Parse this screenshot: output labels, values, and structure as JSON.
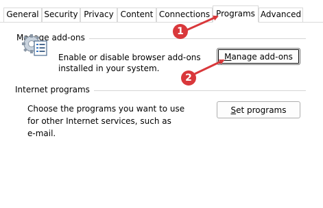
{
  "tabs": [
    {
      "label": "General"
    },
    {
      "label": "Security"
    },
    {
      "label": "Privacy"
    },
    {
      "label": "Content"
    },
    {
      "label": "Connections"
    },
    {
      "label": "Programs"
    },
    {
      "label": "Advanced"
    }
  ],
  "active_tab": "Programs",
  "manage_addons": {
    "group_label": "Manage add-ons",
    "description_line1": "Enable or disable browser add-ons",
    "description_line2": "installed in your system.",
    "button_accel": "M",
    "button_rest": "anage add-ons"
  },
  "internet_programs": {
    "group_label": "Internet programs",
    "description_line1": "Choose the programs you want to use",
    "description_line2": "for other Internet services, such as",
    "description_line3": "e-mail.",
    "button_accel": "S",
    "button_rest": "et programs"
  },
  "annotations": {
    "step1": "1",
    "step2": "2",
    "marker_color": "#d9383b"
  },
  "icons": {
    "addon": "gear-list-icon"
  }
}
